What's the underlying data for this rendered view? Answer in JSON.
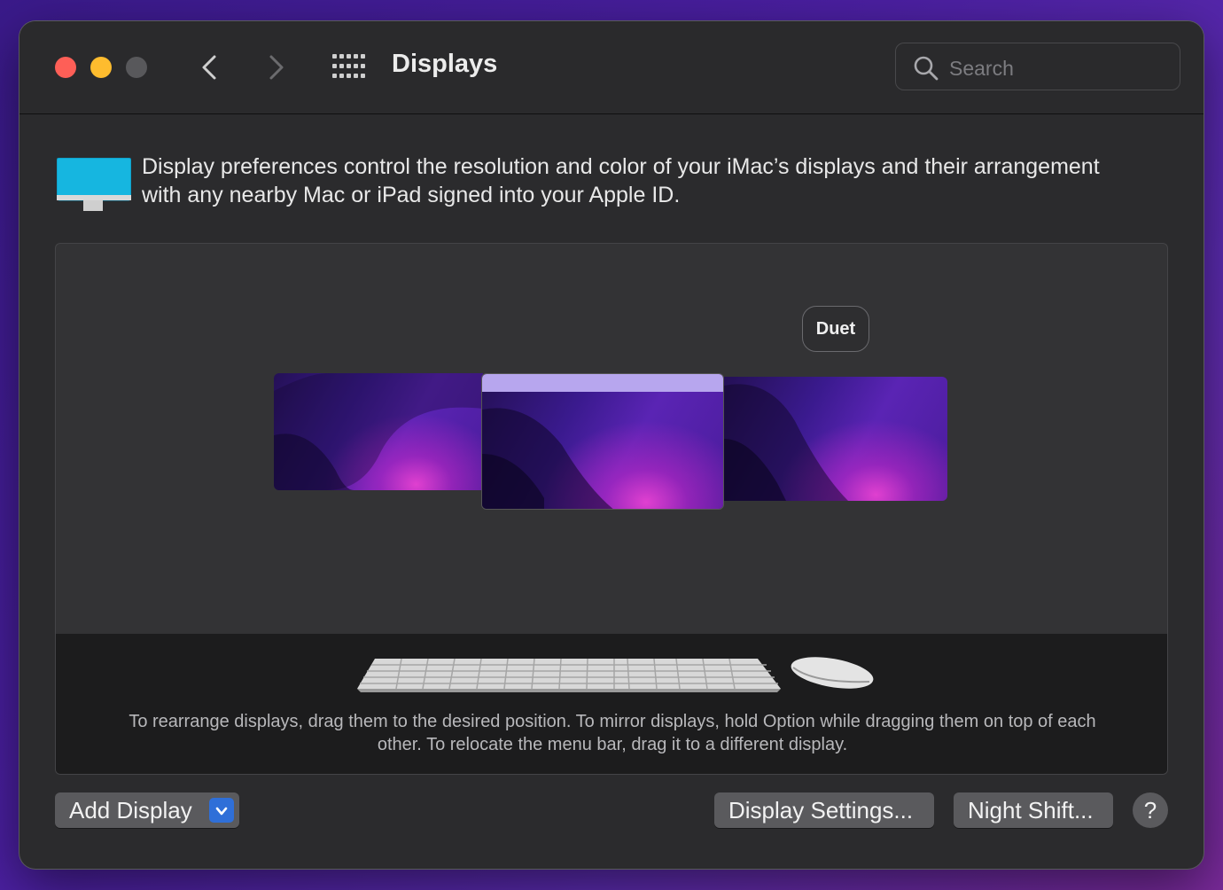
{
  "window": {
    "title": "Displays",
    "search_placeholder": "Search"
  },
  "intro": {
    "text": "Display preferences control the resolution and color of your iMac’s displays and their arrangement with any nearby Mac or iPad signed into your Apple ID."
  },
  "arrangement": {
    "tooltip_label": "Duet",
    "hint": "To rearrange displays, drag them to the desired position. To mirror displays, hold Option while dragging them on top of each other. To relocate the menu bar, drag it to a different display."
  },
  "buttons": {
    "add_display": "Add Display",
    "display_settings": "Display Settings...",
    "night_shift": "Night Shift...",
    "help": "?"
  },
  "icons": {
    "close": "close-traffic-light-icon",
    "minimize": "minimize-traffic-light-icon",
    "zoom": "zoom-traffic-light-icon",
    "back": "chevron-left-icon",
    "forward": "chevron-right-icon",
    "all_prefs": "grid-icon",
    "search": "search-icon",
    "imac": "imac-icon",
    "dropdown": "chevron-down-icon"
  },
  "colors": {
    "close": "#fe5f57",
    "minimize": "#febc2e",
    "zoom": "#58585b",
    "accent": "#2f6fd8",
    "menubar": "#b7a6ee"
  }
}
